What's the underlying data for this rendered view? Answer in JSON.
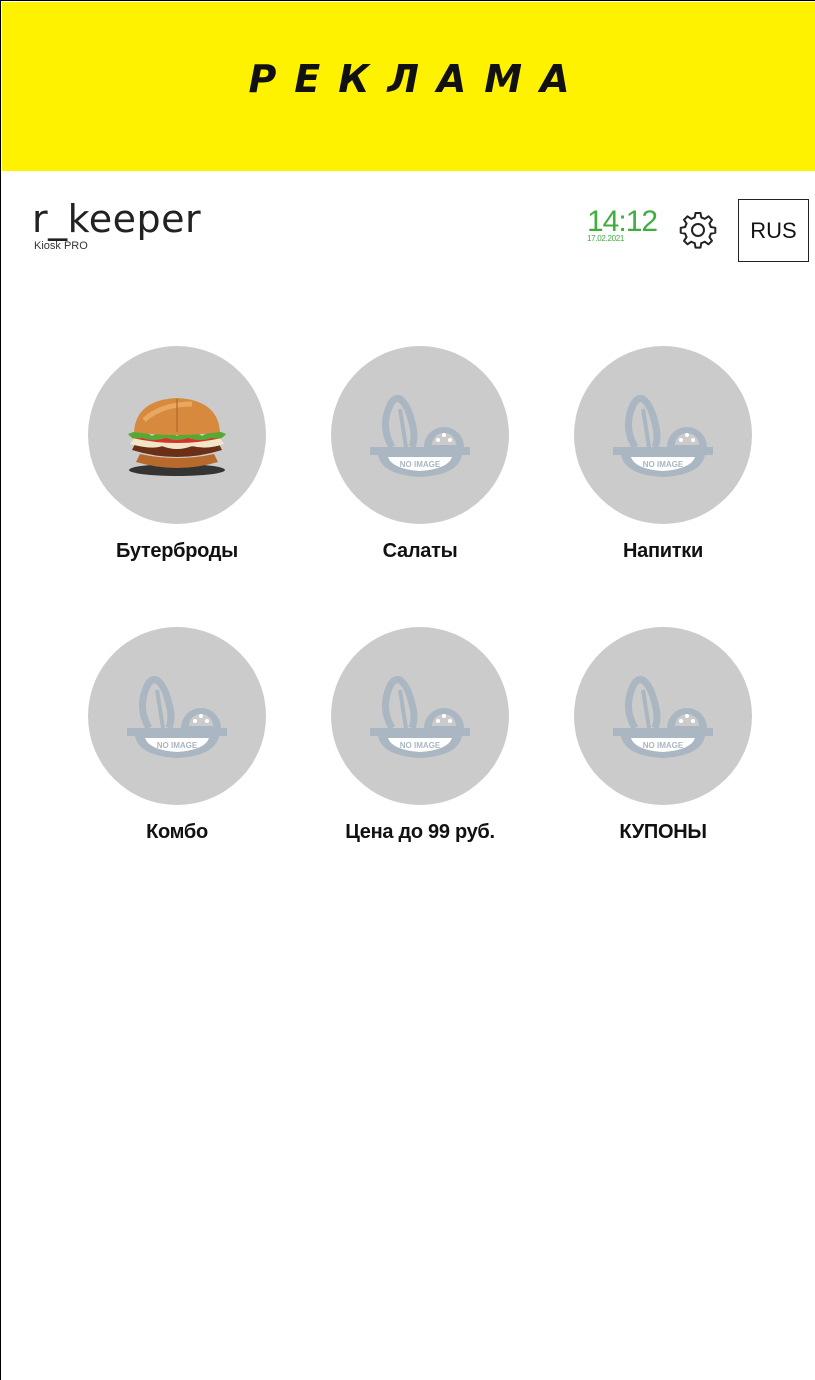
{
  "ad": {
    "text": "РЕКЛАМА"
  },
  "brand": {
    "name": "r_keeper",
    "subtitle": "Kiosk PRO"
  },
  "clock": {
    "time": "14:12",
    "date": "17.02.2021"
  },
  "language": {
    "label": "RUS"
  },
  "categories": [
    {
      "label": "Бутерброды",
      "image": "burger-photo"
    },
    {
      "label": "Салаты",
      "image": "no-image-placeholder",
      "placeholder_text": "NO IMAGE"
    },
    {
      "label": "Напитки",
      "image": "no-image-placeholder",
      "placeholder_text": "NO IMAGE"
    },
    {
      "label": "Комбо",
      "image": "no-image-placeholder",
      "placeholder_text": "NO IMAGE"
    },
    {
      "label": "Цена до 99 руб.",
      "image": "no-image-placeholder",
      "placeholder_text": "NO IMAGE"
    },
    {
      "label": "КУПОНЫ",
      "image": "no-image-placeholder",
      "placeholder_text": "NO IMAGE"
    }
  ],
  "colors": {
    "ad_background": "#fff200",
    "clock_green": "#3fae3f",
    "tile_gray": "#cbcbcb",
    "placeholder_icon": "#aab6c2"
  }
}
